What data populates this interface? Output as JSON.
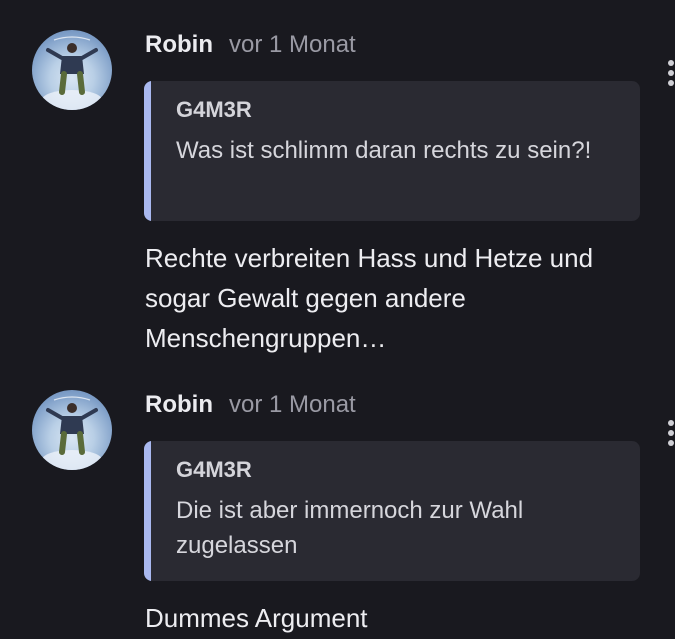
{
  "comments": [
    {
      "author": "Robin",
      "time": "vor 1 Monat",
      "quote": {
        "author": "G4M3R",
        "text": "Was ist schlimm daran rechts zu sein?!"
      },
      "text": "Rechte verbreiten Hass und Hetze und sogar Gewalt gegen andere Menschengruppen…"
    },
    {
      "author": "Robin",
      "time": "vor 1 Monat",
      "quote": {
        "author": "G4M3R",
        "text": "Die ist aber immernoch zur Wahl zugelassen"
      },
      "text": "Dummes Argument"
    }
  ],
  "icons": {
    "avatar": "avatar-person-levitating",
    "menu": "more-vertical-icon"
  },
  "colors": {
    "background": "#19191f",
    "quote_background": "#2a2a32",
    "quote_accent": "#a9b8ef",
    "muted_text": "#9a9aa4"
  }
}
